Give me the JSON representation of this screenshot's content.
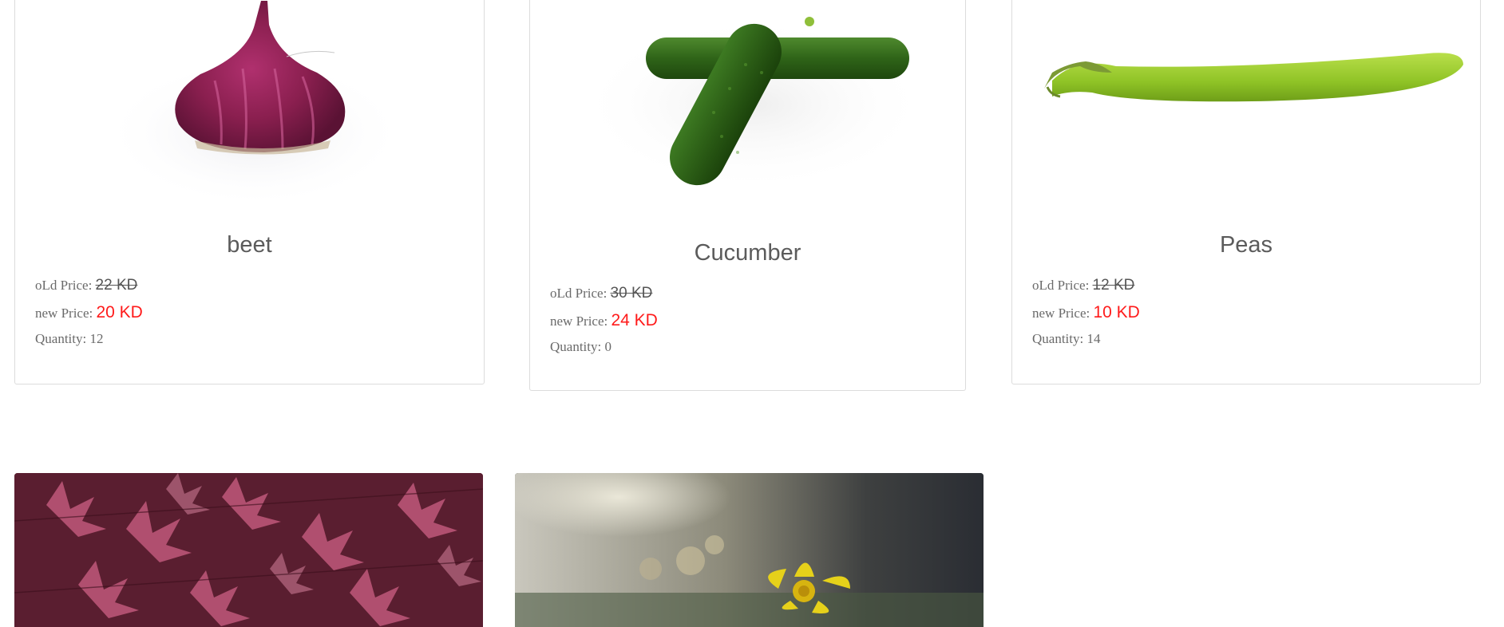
{
  "products": [
    {
      "name": "beet",
      "old_label": "oLd Price:",
      "old_price": "22 KD",
      "new_label": "new Price:",
      "new_price": "20 KD",
      "qty_label": "Quantity:",
      "quantity": "12"
    },
    {
      "name": "Cucumber",
      "old_label": "oLd Price:",
      "old_price": "30 KD",
      "new_label": "new Price:",
      "new_price": "24 KD",
      "qty_label": "Quantity:",
      "quantity": "0"
    },
    {
      "name": "Peas",
      "old_label": "oLd Price:",
      "old_price": "12 KD",
      "new_label": "new Price:",
      "new_price": "10 KD",
      "qty_label": "Quantity:",
      "quantity": "14"
    }
  ],
  "colors": {
    "new_price": "#ff1a1a",
    "card_border": "#dcdcdc",
    "text": "#6a6a6a"
  }
}
